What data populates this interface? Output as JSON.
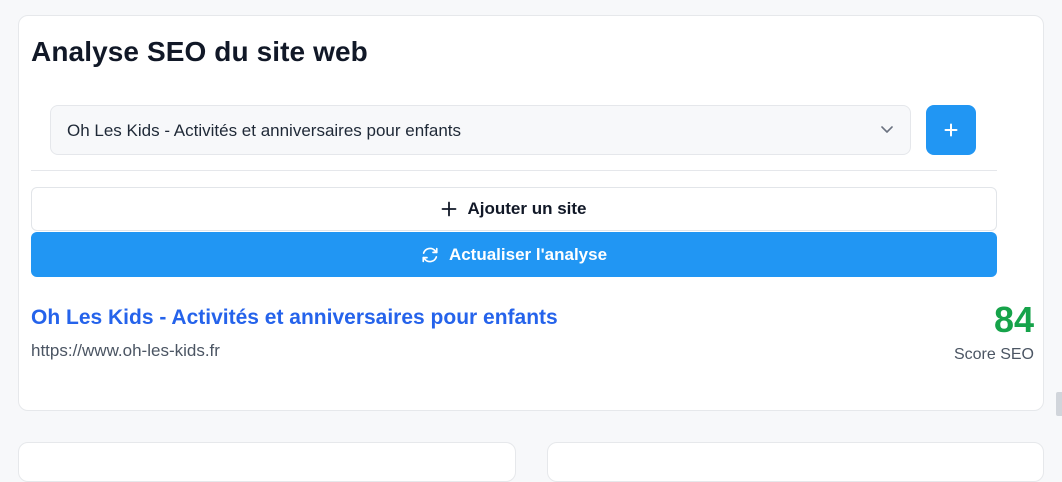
{
  "card": {
    "title": "Analyse SEO du site web"
  },
  "site_select": {
    "selected": "Oh Les Kids - Activités et anniversaires pour enfants",
    "icon": "chevron-down-icon"
  },
  "plus_button": {
    "icon": "plus-icon"
  },
  "actions": {
    "add_site_label": "Ajouter un site",
    "add_site_icon": "plus-icon",
    "refresh_label": "Actualiser l'analyse",
    "refresh_icon": "refresh-icon"
  },
  "site": {
    "name": "Oh Les Kids - Activités et anniversaires pour enfants",
    "url": "https://www.oh-les-kids.fr",
    "score": "84",
    "score_label": "Score SEO"
  },
  "colors": {
    "accent": "#2196f3",
    "link": "#2563eb",
    "score_good": "#16a34a"
  }
}
